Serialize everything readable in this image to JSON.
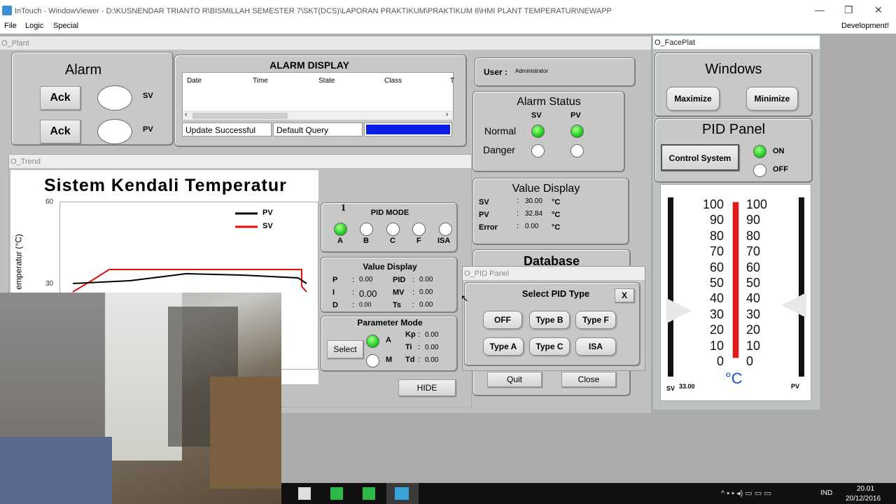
{
  "titlebar": {
    "title": "InTouch - WindowViewer - D:\\KUSNENDAR TRIANTO R\\BISMILLAH SEMESTER 7\\SKT(DCS)\\LAPORAN PRAKTIKUM\\PRAKTIKUM 6\\HMI PLANT TEMPERATUR\\NEWAPP"
  },
  "menu": {
    "file": "File",
    "logic": "Logic",
    "special": "Special",
    "right": "Development!"
  },
  "plant": {
    "window_title": "O_Plant",
    "alarm": {
      "title": "Alarm",
      "ack1": "Ack",
      "ack2": "Ack",
      "sv": "SV",
      "pv": "PV"
    },
    "alarm_display": {
      "title": "ALARM DISPLAY",
      "columns": [
        "Date",
        "Time",
        "State",
        "Class",
        "T"
      ],
      "status": "Update Successful",
      "query": "Default Query"
    },
    "user": {
      "label": "User :",
      "name": "Administrator"
    },
    "alarm_status": {
      "title": "Alarm Status",
      "sv": "SV",
      "pv": "PV",
      "normal": "Normal",
      "danger": "Danger"
    },
    "value_display": {
      "title": "Value Display",
      "rows": [
        {
          "label": "SV",
          "value": "30.00",
          "unit": "°C"
        },
        {
          "label": "PV",
          "value": "32.84",
          "unit": "°C"
        },
        {
          "label": "Error",
          "value": "0.00",
          "unit": "°C"
        }
      ]
    },
    "database": {
      "title": "Database",
      "quit": "Quit",
      "close": "Close"
    }
  },
  "trend": {
    "window_title": "O_Trend",
    "title": "Sistem Kendali Temperatur",
    "ylabel": "emperatur (°C)",
    "y_ticks": [
      "60",
      "30"
    ],
    "legend": {
      "pv": "PV",
      "sv": "SV"
    },
    "pid_mode": {
      "number": "1",
      "title": "PID MODE",
      "modes": [
        "A",
        "B",
        "C",
        "F",
        "ISA"
      ]
    },
    "value_display": {
      "title": "Value Display",
      "p_label": "P",
      "p": "0.00",
      "i_label": "I",
      "i": "0.00",
      "d_label": "D",
      "d": "0.00",
      "pid_label": "PID",
      "pid": "0.00",
      "mv_label": "MV",
      "mv": "0.00",
      "ts_label": "Ts",
      "ts": "0.00"
    },
    "param_mode": {
      "title": "Parameter Mode",
      "select": "Select",
      "a": "A",
      "m": "M",
      "kp_label": "Kp",
      "kp": "0.00",
      "ti_label": "Ti",
      "ti": "0.00",
      "td_label": "Td",
      "td": "0.00"
    },
    "hide": "HIDE"
  },
  "pid_panel_popup": {
    "window_title": "O_PID Panel",
    "title": "Select PID Type",
    "close": "X",
    "buttons": [
      "OFF",
      "Type B",
      "Type F",
      "Type A",
      "Type C",
      "ISA"
    ]
  },
  "faceplate": {
    "window_title": "O_FacePlat",
    "windows": {
      "title": "Windows",
      "maximize": "Maximize",
      "minimize": "Minimize"
    },
    "pid": {
      "title": "PID Panel",
      "control": "Control System",
      "on": "ON",
      "off": "OFF"
    },
    "thermo": {
      "scale": [
        "100",
        "90",
        "80",
        "70",
        "60",
        "50",
        "40",
        "30",
        "20",
        "10",
        "0"
      ],
      "unit": "°C",
      "sv_label": "SV",
      "sv_value": "33.00",
      "pv_label": "PV"
    }
  },
  "taskbar": {
    "lang": "IND",
    "time": "20.01",
    "date": "20/12/2016"
  }
}
